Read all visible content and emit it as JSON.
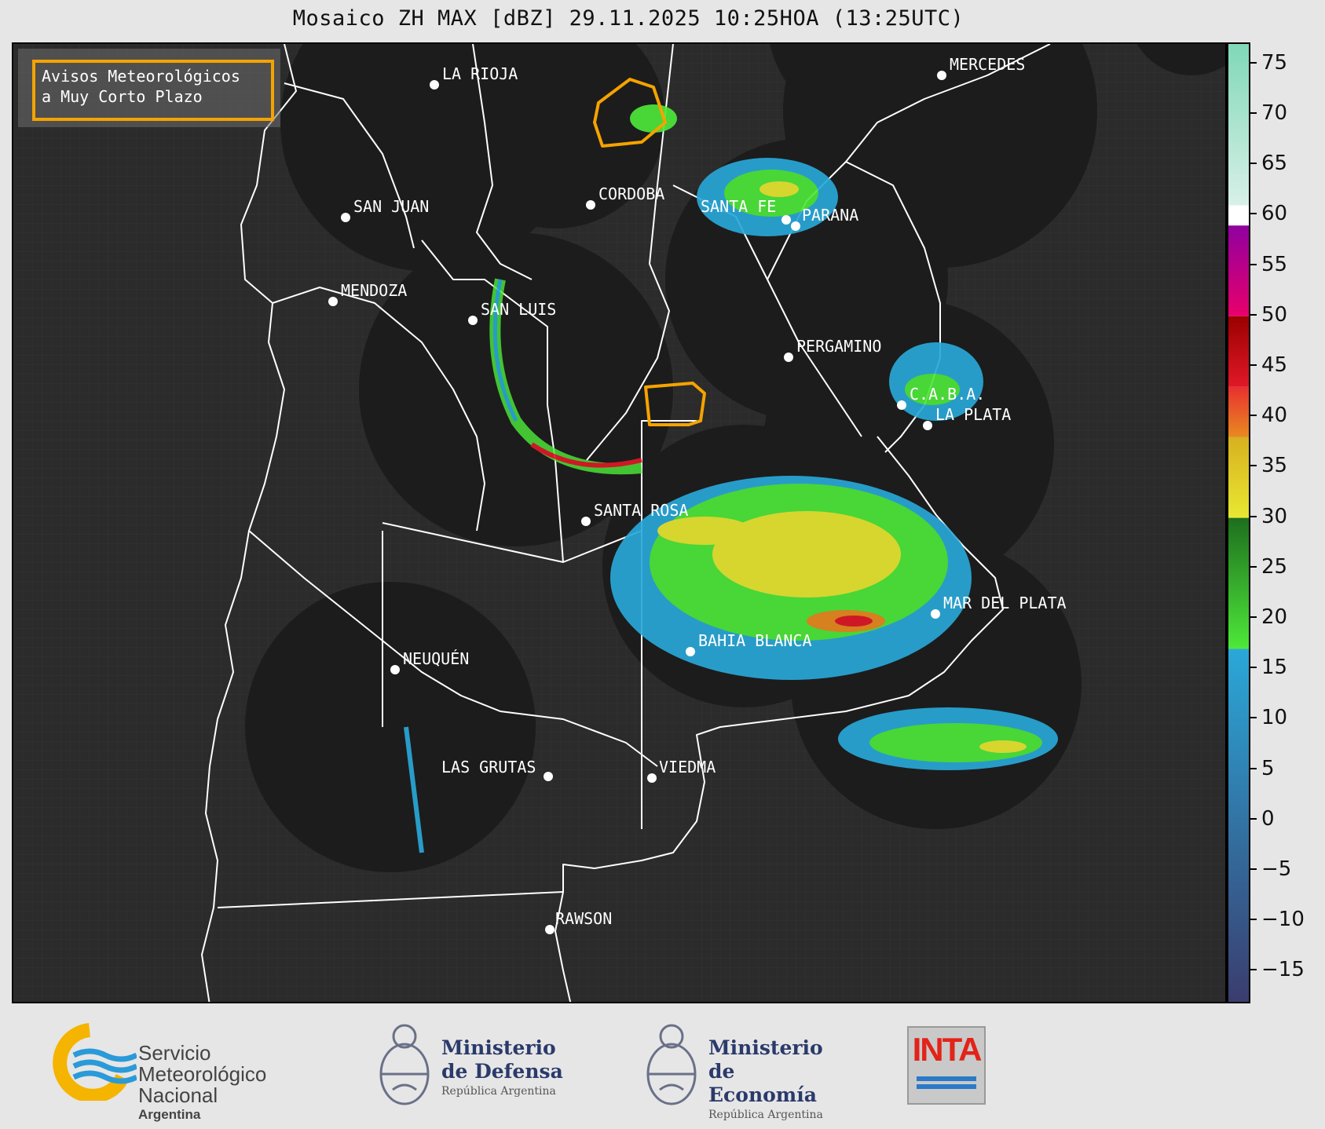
{
  "title": "Mosaico ZH MAX [dBZ] 29.11.2025 10:25HOA (13:25UTC)",
  "legend_box": {
    "line1": "Avisos Meteorológicos",
    "line2": "a Muy Corto Plazo",
    "border_color": "#f5a300"
  },
  "cities": [
    {
      "name": "LA RIOJA"
    },
    {
      "name": "MERCEDES"
    },
    {
      "name": "CORDOBA"
    },
    {
      "name": "SAN JUAN"
    },
    {
      "name": "SANTA FE"
    },
    {
      "name": "PARANA"
    },
    {
      "name": "MENDOZA"
    },
    {
      "name": "SAN LUIS"
    },
    {
      "name": "PERGAMINO"
    },
    {
      "name": "C.A.B.A."
    },
    {
      "name": "LA PLATA"
    },
    {
      "name": "SANTA ROSA"
    },
    {
      "name": "MAR DEL PLATA"
    },
    {
      "name": "BAHIA BLANCA"
    },
    {
      "name": "NEUQUÉN"
    },
    {
      "name": "LAS GRUTAS"
    },
    {
      "name": "VIEDMA"
    },
    {
      "name": "RAWSON"
    }
  ],
  "colorbar": {
    "min": -18,
    "max": 77,
    "tick_labels": [
      "75",
      "70",
      "65",
      "60",
      "55",
      "50",
      "45",
      "40",
      "35",
      "30",
      "25",
      "20",
      "15",
      "10",
      "5",
      "0",
      "−5",
      "−10",
      "−15"
    ],
    "tick_values": [
      75,
      70,
      65,
      60,
      55,
      50,
      45,
      40,
      35,
      30,
      25,
      20,
      15,
      10,
      5,
      0,
      -5,
      -10,
      -15
    ],
    "bands": [
      {
        "from": -18,
        "to": 17,
        "color_low": "#3a3d6e",
        "color_high": "#2aa8d8"
      },
      {
        "from": 17,
        "to": 30,
        "color_low": "#4ee83a",
        "color_high": "#1e6e1e"
      },
      {
        "from": 30,
        "to": 38,
        "color_low": "#e8e832",
        "color_high": "#d8b020"
      },
      {
        "from": 38,
        "to": 43,
        "color_low": "#e88a20",
        "color_high": "#e83030"
      },
      {
        "from": 43,
        "to": 50,
        "color_low": "#e01828",
        "color_high": "#9a0000"
      },
      {
        "from": 50,
        "to": 59,
        "color_low": "#e8006a",
        "color_high": "#9000a0"
      },
      {
        "from": 59,
        "to": 61,
        "color_low": "#ffffff",
        "color_high": "#ffffff"
      },
      {
        "from": 61,
        "to": 77,
        "color_low": "#d8f0e8",
        "color_high": "#80d8b8"
      }
    ]
  },
  "colors": {
    "map_background": "#2b2b2b",
    "radar_disc": "#1c1c1c",
    "warning_polygon": "#f5a300",
    "province_border": "#ffffff"
  },
  "footer": {
    "smn": {
      "line1": "Servicio",
      "line2": "Meteorológico",
      "line3": "Nacional",
      "line4": "Argentina"
    },
    "defensa": {
      "line1": "Ministerio",
      "line2": "de Defensa",
      "line3": "República Argentina"
    },
    "economia": {
      "line1": "Ministerio",
      "line2": "de Economía",
      "line3": "República Argentina"
    },
    "inta": {
      "word": "INTA"
    }
  }
}
